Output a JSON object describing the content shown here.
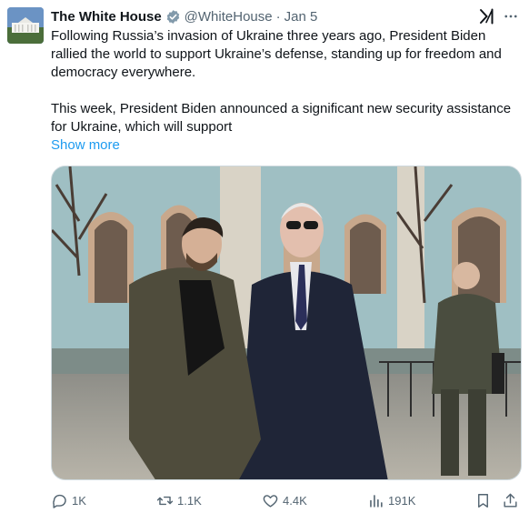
{
  "tweet": {
    "author_name": "The White House",
    "handle": "@WhiteHouse",
    "separator": "·",
    "date": "Jan 5",
    "text_paragraph_1": "Following Russia’s invasion of Ukraine three years ago, President Biden rallied the world to support Ukraine’s defense, standing up for freedom and democracy everywhere.",
    "text_paragraph_2": "This week, President Biden announced a significant new security assistance for Ukraine, which will support",
    "show_more": "Show more"
  },
  "actions": {
    "replies": "1K",
    "reposts": "1.1K",
    "likes": "4.4K",
    "views": "191K"
  },
  "icons": {
    "verified": "verified-badge-icon",
    "grok": "grok-icon",
    "more": "more-icon",
    "reply": "reply-icon",
    "repost": "repost-icon",
    "like": "heart-icon",
    "views": "views-icon",
    "bookmark": "bookmark-icon",
    "share": "share-icon"
  },
  "colors": {
    "link": "#1d9bf0",
    "secondary_text": "#536471",
    "primary_text": "#0f1419"
  }
}
